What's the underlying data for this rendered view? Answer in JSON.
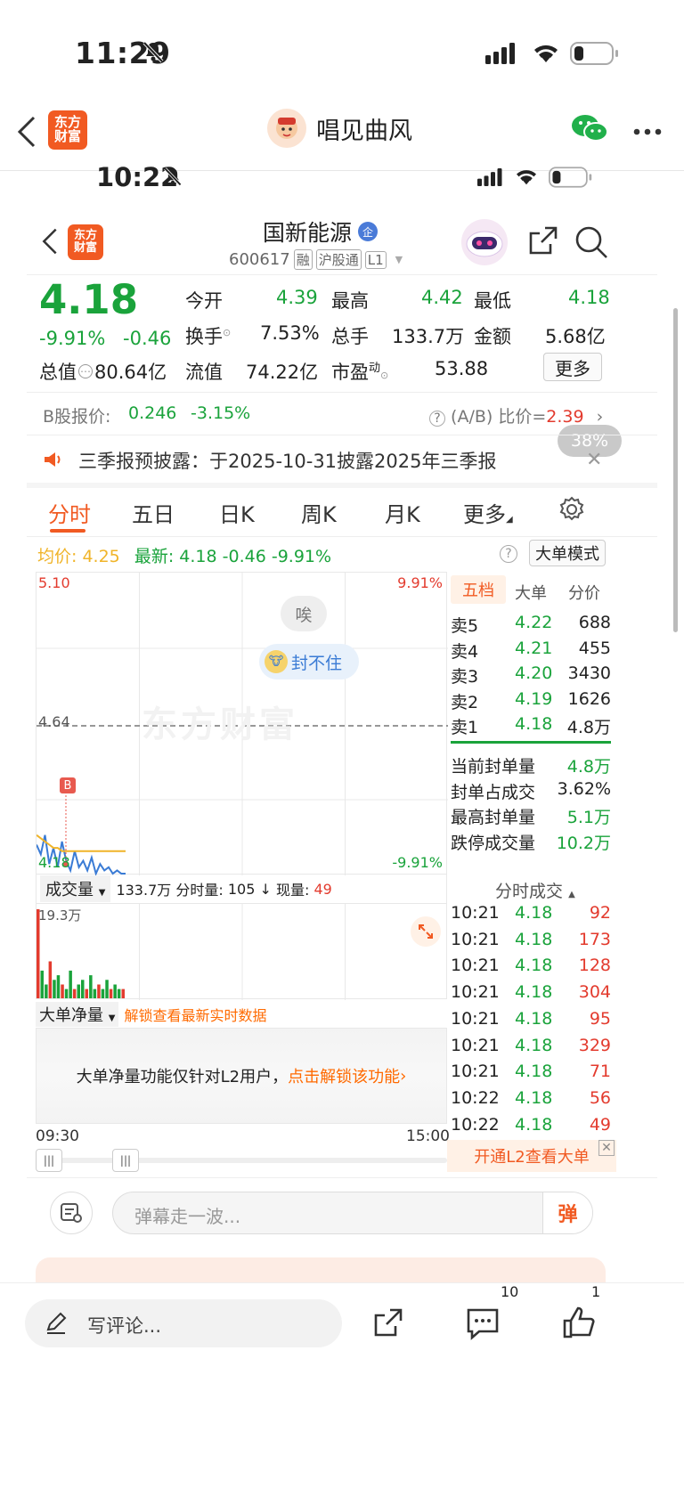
{
  "outer_status": {
    "time": "11:29"
  },
  "wechat_nav": {
    "logo_line1": "东方",
    "logo_line2": "财富",
    "title": "唱见曲风"
  },
  "inner_status": {
    "time": "10:22"
  },
  "stock_header": {
    "logo_line1": "东方",
    "logo_line2": "财富",
    "name": "国新能源",
    "badge": "企",
    "code": "600617",
    "tag_rong": "融",
    "tag_hgt": "沪股通",
    "tag_level": "L1"
  },
  "quote": {
    "price": "4.18",
    "change_pct": "-9.91%",
    "change": "-0.46",
    "open_label": "今开",
    "open": "4.39",
    "high_label": "最高",
    "high": "4.42",
    "low_label": "最低",
    "low": "4.18",
    "turnover_label": "换手",
    "turnover": "7.53%",
    "volume_label": "总手",
    "volume": "133.7万",
    "amount_label": "金额",
    "amount": "5.68亿",
    "mktcap_label": "总值",
    "mktcap": "80.64亿",
    "float_label": "流值",
    "float": "74.22亿",
    "pe_label": "市盈",
    "pe_sup": "动",
    "pe": "53.88",
    "more_btn": "更多"
  },
  "b_share": {
    "label": "B股报价:",
    "price": "0.246",
    "change": "-3.15%",
    "ratio_label": "(A/B) 比价=",
    "ratio": "2.39"
  },
  "zoom_badge": "38%",
  "notice": {
    "text": "三季报预披露：于2025-10-31披露2025年三季报"
  },
  "tabs": [
    "分时",
    "五日",
    "日K",
    "周K",
    "月K",
    "更多"
  ],
  "summary": {
    "avg_label": "均价:",
    "avg": "4.25",
    "latest_label": "最新:",
    "latest": "4.18",
    "chg": "-0.46",
    "pct": "-9.91%",
    "mode_btn": "大单模式"
  },
  "chart_labels": {
    "top_price": "5.10",
    "top_pct": "9.91%",
    "mid_price": "4.64",
    "bot_price": "4.18",
    "bot_pct": "-9.91%",
    "sigh": "唉",
    "limit_text": "封不住",
    "b_marker": "B",
    "watermark": "东方财富"
  },
  "orderbook": {
    "tabs": [
      "五档",
      "大单",
      "分价"
    ],
    "asks": [
      {
        "label": "卖5",
        "price": "4.22",
        "vol": "688"
      },
      {
        "label": "卖4",
        "price": "4.21",
        "vol": "455"
      },
      {
        "label": "卖3",
        "price": "4.20",
        "vol": "3430"
      },
      {
        "label": "卖2",
        "price": "4.19",
        "vol": "1626"
      },
      {
        "label": "卖1",
        "price": "4.18",
        "vol": "4.8万"
      }
    ],
    "stats": [
      {
        "label": "当前封单量",
        "value": "4.8万"
      },
      {
        "label": "封单占成交",
        "value": "3.62%"
      },
      {
        "label": "最高封单量",
        "value": "5.1万"
      },
      {
        "label": "跌停成交量",
        "value": "10.2万"
      }
    ]
  },
  "volume_bar": {
    "select": "成交量",
    "total": "133.7万",
    "minute_label": "分时量:",
    "minute": "105",
    "now_label": "现量:",
    "now": "49",
    "max": "19.3万"
  },
  "trades": {
    "title": "分时成交",
    "rows": [
      {
        "time": "10:21",
        "price": "4.18",
        "vol": "92"
      },
      {
        "time": "10:21",
        "price": "4.18",
        "vol": "173"
      },
      {
        "time": "10:21",
        "price": "4.18",
        "vol": "128"
      },
      {
        "time": "10:21",
        "price": "4.18",
        "vol": "304"
      },
      {
        "time": "10:21",
        "price": "4.18",
        "vol": "95"
      },
      {
        "time": "10:21",
        "price": "4.18",
        "vol": "329"
      },
      {
        "time": "10:21",
        "price": "4.18",
        "vol": "71"
      },
      {
        "time": "10:22",
        "price": "4.18",
        "vol": "56"
      },
      {
        "time": "10:22",
        "price": "4.18",
        "vol": "49"
      }
    ],
    "l2_banner": "开通L2查看大单"
  },
  "net_big": {
    "select": "大单净量",
    "unlock_link": "解锁查看最新实时数据",
    "notice": "大单净量功能仅针对L2用户，",
    "notice_link": "点击解锁该功能"
  },
  "time_axis": {
    "start": "09:30",
    "end": "15:00"
  },
  "danmu": {
    "placeholder": "弹幕走一波...",
    "btn": "弹"
  },
  "bottom_bar": {
    "comment_placeholder": "写评论...",
    "comment_count": "10",
    "like_count": "1"
  },
  "colors": {
    "brand": "#f15a22",
    "green": "#1aa33b",
    "red": "#e33b2e",
    "price_line": "#3a7bd5",
    "avg_line": "#f0b429"
  },
  "chart_data": {
    "type": "line",
    "title": "",
    "ylim": [
      4.18,
      5.1
    ],
    "y_ref": 4.64,
    "series": [
      {
        "values": [
          4.27,
          4.24,
          4.3,
          4.21,
          4.26,
          4.2,
          4.28,
          4.22,
          4.19,
          4.25,
          4.2,
          4.22,
          4.19,
          4.23,
          4.18,
          4.21,
          4.19,
          4.2,
          4.18,
          4.19,
          4.18,
          4.18
        ]
      },
      {
        "values": [
          4.3,
          4.29,
          4.28,
          4.27,
          4.26,
          4.26,
          4.25,
          4.25,
          4.25,
          4.25,
          4.25,
          4.25,
          4.25,
          4.25,
          4.25,
          4.25,
          4.25,
          4.25,
          4.25,
          4.25,
          4.25,
          4.25
        ]
      }
    ],
    "volume": [
      19.3,
      6,
      3,
      8,
      4,
      5,
      3,
      2,
      6,
      2,
      3,
      4,
      2,
      5,
      2,
      3,
      2,
      4,
      2,
      3,
      2,
      2
    ]
  }
}
